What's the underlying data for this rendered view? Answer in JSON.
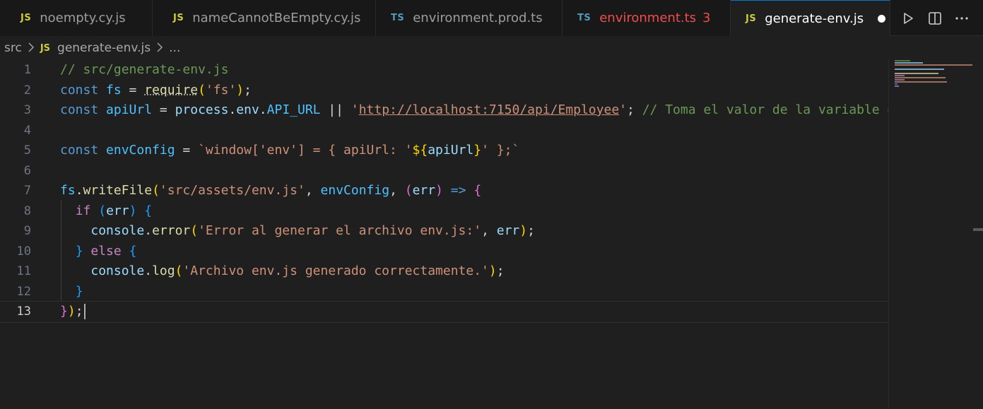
{
  "tabs": [
    {
      "type": "JS",
      "label": "noempty.cy.js"
    },
    {
      "type": "JS",
      "label": "nameCannotBeEmpty.cy.js"
    },
    {
      "type": "TS",
      "label": "environment.prod.ts"
    },
    {
      "type": "TS",
      "label": "environment.ts",
      "problems": "3"
    },
    {
      "type": "JS",
      "label": "generate-env.js"
    }
  ],
  "breadcrumb": {
    "folder": "src",
    "file_type": "JS",
    "file": "generate-env.js",
    "more": "..."
  },
  "line_numbers": [
    "1",
    "2",
    "3",
    "4",
    "5",
    "6",
    "7",
    "8",
    "9",
    "10",
    "11",
    "12",
    "13"
  ],
  "code": {
    "l1_comment": "// src/generate-env.js",
    "l2_const": "const",
    "l2_fs": "fs",
    "l2_eq": " = ",
    "l2_require": "require",
    "l2_str": "'fs'",
    "l3_const": "const",
    "l3_apiUrl": "apiUrl",
    "l3_eq": " = ",
    "l3_process": "process",
    "l3_env": "env",
    "l3_api_url": "API_URL",
    "l3_or": " || ",
    "l3_q1": "'",
    "l3_url": "http://localhost:7150/api/Employee",
    "l3_q2": "'",
    "l3_comment": "// Toma el valor de la variable de entorno o usa un valor por defecto",
    "l5_const": "const",
    "l5_envConfig": "envConfig",
    "l5_eq": " = ",
    "l5_tpl_a": "`window['env'] = { apiUrl: '",
    "l5_tpl_open": "${",
    "l5_tpl_var": "apiUrl",
    "l5_tpl_close": "}",
    "l5_tpl_b": "' };`",
    "l7_fs": "fs",
    "l7_writeFile": "writeFile",
    "l7_str": "'src/assets/env.js'",
    "l7_envConfig": "envConfig",
    "l7_err": "err",
    "l7_arrow": " => ",
    "l8_if": "if",
    "l8_err": "err",
    "l9_console": "console",
    "l9_error": "error",
    "l9_str": "'Error al generar el archivo env.js:'",
    "l9_err": "err",
    "l10_else": "else",
    "l11_console": "console",
    "l11_log": "log",
    "l11_str": "'Archivo env.js generado correctamente.'"
  },
  "colors": {
    "keyword": "#569cd6",
    "control": "#c586c0",
    "variable": "#9cdcfe",
    "string": "#ce9178",
    "comment": "#6a9955",
    "function": "#dcdcaa",
    "error": "#f14c4c"
  },
  "icons": [
    "run-icon",
    "split-editor-icon",
    "more-actions-icon",
    "chevron-right-icon"
  ]
}
